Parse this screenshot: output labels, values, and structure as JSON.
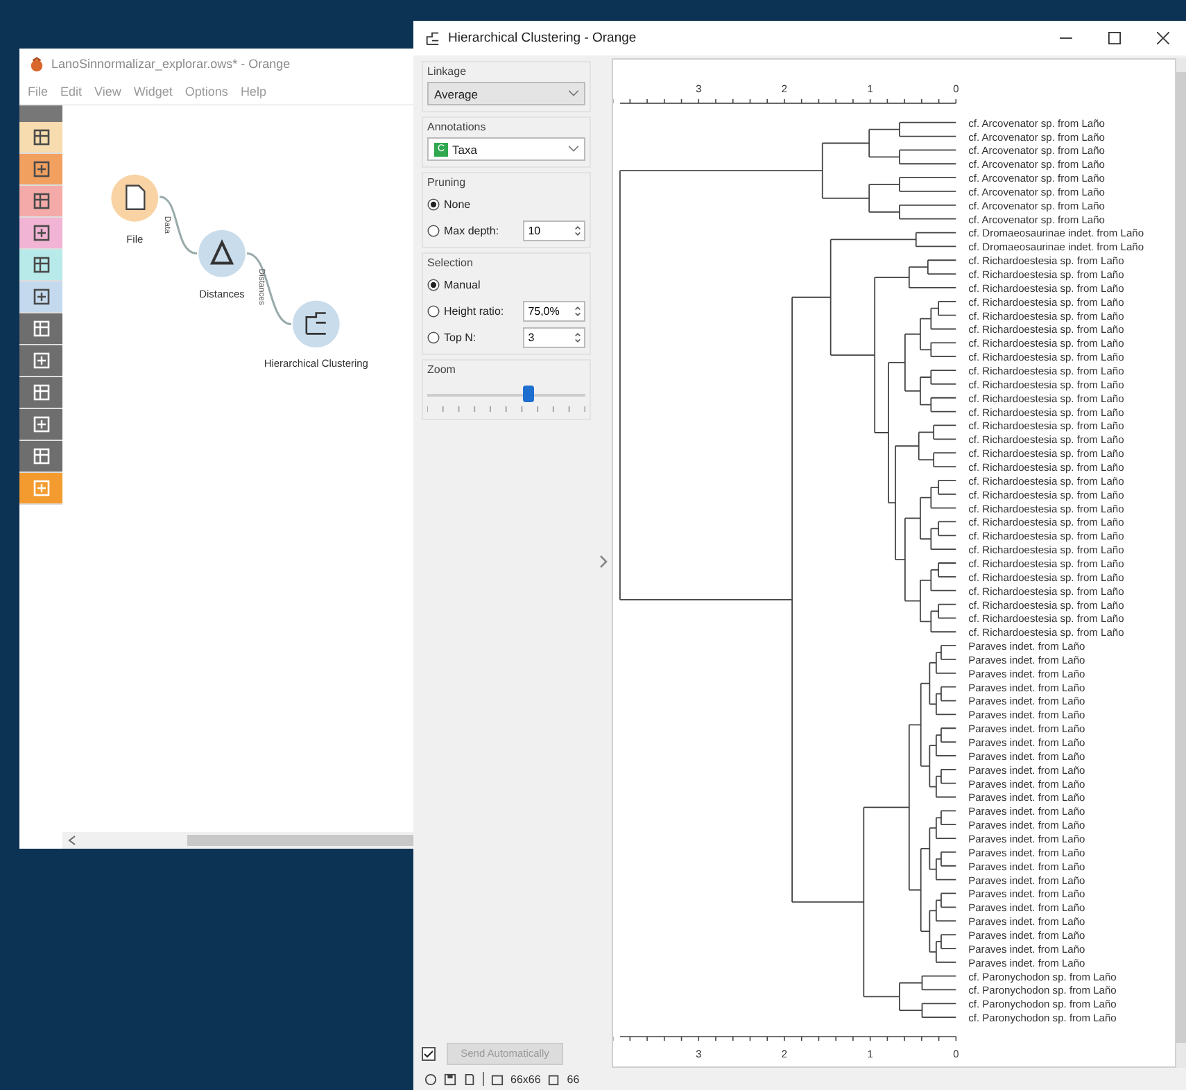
{
  "canvas_window": {
    "title": "LanoSinnormalizar_explorar.ows* - Orange",
    "menu": [
      "File",
      "Edit",
      "View",
      "Widget",
      "Options",
      "Help"
    ],
    "nodes": [
      {
        "label": "File"
      },
      {
        "label": "Distances"
      },
      {
        "label": "Hierarchical Clustering"
      }
    ],
    "links": [
      {
        "label": "Data"
      },
      {
        "label": "Distances"
      }
    ]
  },
  "widget_window": {
    "title": "Hierarchical Clustering - Orange",
    "linkage": {
      "title": "Linkage",
      "value": "Average"
    },
    "annotations": {
      "title": "Annotations",
      "badge": "C",
      "value": "Taxa"
    },
    "pruning": {
      "title": "Pruning",
      "options": [
        {
          "label": "None",
          "selected": true
        },
        {
          "label": "Max depth:",
          "selected": false,
          "value": "10"
        }
      ]
    },
    "selection": {
      "title": "Selection",
      "options": [
        {
          "label": "Manual",
          "selected": true
        },
        {
          "label": "Height ratio:",
          "selected": false,
          "value": "75,0%"
        },
        {
          "label": "Top N:",
          "selected": false,
          "value": "3"
        }
      ]
    },
    "zoom": {
      "title": "Zoom",
      "level": 0.64
    },
    "send_automatically": {
      "checked": true,
      "label": "Send Automatically",
      "disabled": true
    },
    "top_axis_ticks": [
      "3",
      "2",
      "1",
      "0"
    ],
    "bottom_axis_ticks": [
      "3",
      "2",
      "1",
      "0"
    ],
    "leaves": [
      "cf. Arcovenator sp. from Laño",
      "cf. Arcovenator sp. from Laño",
      "cf. Arcovenator sp. from Laño",
      "cf. Arcovenator sp. from Laño",
      "cf. Arcovenator sp. from Laño",
      "cf. Arcovenator sp. from Laño",
      "cf. Arcovenator sp. from Laño",
      "cf. Arcovenator sp. from Laño",
      "cf. Dromaeosaurinae indet. from Laño",
      "cf. Dromaeosaurinae indet. from Laño",
      "cf. Richardoestesia sp. from Laño",
      "cf. Richardoestesia sp. from Laño",
      "cf. Richardoestesia sp. from Laño",
      "cf. Richardoestesia sp. from Laño",
      "cf. Richardoestesia sp. from Laño",
      "cf. Richardoestesia sp. from Laño",
      "cf. Richardoestesia sp. from Laño",
      "cf. Richardoestesia sp. from Laño",
      "cf. Richardoestesia sp. from Laño",
      "cf. Richardoestesia sp. from Laño",
      "cf. Richardoestesia sp. from Laño",
      "cf. Richardoestesia sp. from Laño",
      "cf. Richardoestesia sp. from Laño",
      "cf. Richardoestesia sp. from Laño",
      "cf. Richardoestesia sp. from Laño",
      "cf. Richardoestesia sp. from Laño",
      "cf. Richardoestesia sp. from Laño",
      "cf. Richardoestesia sp. from Laño",
      "cf. Richardoestesia sp. from Laño",
      "cf. Richardoestesia sp. from Laño",
      "cf. Richardoestesia sp. from Laño",
      "cf. Richardoestesia sp. from Laño",
      "cf. Richardoestesia sp. from Laño",
      "cf. Richardoestesia sp. from Laño",
      "cf. Richardoestesia sp. from Laño",
      "cf. Richardoestesia sp. from Laño",
      "cf. Richardoestesia sp. from Laño",
      "cf. Richardoestesia sp. from Laño",
      "Paraves indet. from Laño",
      "Paraves indet. from Laño",
      "Paraves indet. from Laño",
      "Paraves indet. from Laño",
      "Paraves indet. from Laño",
      "Paraves indet. from Laño",
      "Paraves indet. from Laño",
      "Paraves indet. from Laño",
      "Paraves indet. from Laño",
      "Paraves indet. from Laño",
      "Paraves indet. from Laño",
      "Paraves indet. from Laño",
      "Paraves indet. from Laño",
      "Paraves indet. from Laño",
      "Paraves indet. from Laño",
      "Paraves indet. from Laño",
      "Paraves indet. from Laño",
      "Paraves indet. from Laño",
      "Paraves indet. from Laño",
      "Paraves indet. from Laño",
      "Paraves indet. from Laño",
      "Paraves indet. from Laño",
      "Paraves indet. from Laño",
      "Paraves indet. from Laño",
      "cf. Paronychodon sp. from Laño",
      "cf. Paronychodon sp. from Laño",
      "cf. Paronychodon sp. from Laño",
      "cf. Paronychodon sp. from Laño"
    ],
    "status": {
      "size": "66x66",
      "count": "66"
    }
  }
}
